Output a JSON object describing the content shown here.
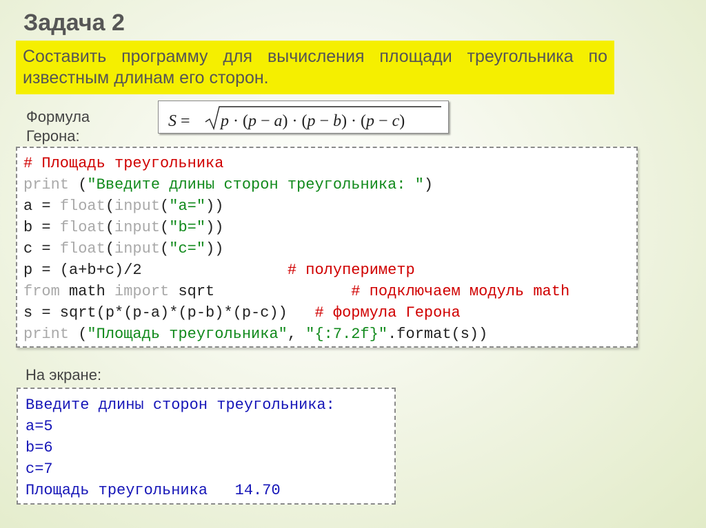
{
  "slide": {
    "title": "Задача 2",
    "task": "Составить программу для вычисления площади треугольника по известным длинам его сторон."
  },
  "formula": {
    "label": "Формула Герона:",
    "text": "S = √(p · (p − a) · (p − b) · (p − c))"
  },
  "code": {
    "lines": [
      [
        {
          "t": "# Площадь треугольника",
          "c": "cmt"
        }
      ],
      [
        {
          "t": "print",
          "c": "kw"
        },
        {
          "t": " (",
          "c": ""
        },
        {
          "t": "\"Введите длины сторон треугольника: \"",
          "c": "str"
        },
        {
          "t": ")",
          "c": ""
        }
      ],
      [
        {
          "t": "a = ",
          "c": ""
        },
        {
          "t": "float",
          "c": "kw"
        },
        {
          "t": "(",
          "c": ""
        },
        {
          "t": "input",
          "c": "kw"
        },
        {
          "t": "(",
          "c": ""
        },
        {
          "t": "\"a=\"",
          "c": "str"
        },
        {
          "t": "))",
          "c": ""
        }
      ],
      [
        {
          "t": "b = ",
          "c": ""
        },
        {
          "t": "float",
          "c": "kw"
        },
        {
          "t": "(",
          "c": ""
        },
        {
          "t": "input",
          "c": "kw"
        },
        {
          "t": "(",
          "c": ""
        },
        {
          "t": "\"b=\"",
          "c": "str"
        },
        {
          "t": "))",
          "c": ""
        }
      ],
      [
        {
          "t": "c = ",
          "c": ""
        },
        {
          "t": "float",
          "c": "kw"
        },
        {
          "t": "(",
          "c": ""
        },
        {
          "t": "input",
          "c": "kw"
        },
        {
          "t": "(",
          "c": ""
        },
        {
          "t": "\"c=\"",
          "c": "str"
        },
        {
          "t": "))",
          "c": ""
        }
      ],
      [
        {
          "t": "p = (a+b+c)/2                ",
          "c": ""
        },
        {
          "t": "# полупериметр",
          "c": "cmt"
        }
      ],
      [
        {
          "t": "from",
          "c": "kw"
        },
        {
          "t": " math ",
          "c": ""
        },
        {
          "t": "import",
          "c": "kw"
        },
        {
          "t": " sqrt               ",
          "c": ""
        },
        {
          "t": "# подключаем модуль math",
          "c": "cmt"
        }
      ],
      [
        {
          "t": "s = sqrt(p*(p-a)*(p-b)*(p-c))   ",
          "c": ""
        },
        {
          "t": "# формула Герона",
          "c": "cmt"
        }
      ],
      [
        {
          "t": "print",
          "c": "kw"
        },
        {
          "t": " (",
          "c": ""
        },
        {
          "t": "\"Площадь треугольника\"",
          "c": "str"
        },
        {
          "t": ", ",
          "c": ""
        },
        {
          "t": "\"{:7.2f}\"",
          "c": "str"
        },
        {
          "t": ".format(s))",
          "c": ""
        }
      ]
    ]
  },
  "output": {
    "label": "На экране:",
    "lines": [
      "Введите длины сторон треугольника:",
      "a=5",
      "b=6",
      "c=7",
      "Площадь треугольника   14.70"
    ]
  },
  "colors": {
    "highlight": "#f5ef00",
    "comment": "#d00000",
    "string": "#118a1c",
    "keyword": "#a9a9a9",
    "output_text": "#1616b8"
  }
}
